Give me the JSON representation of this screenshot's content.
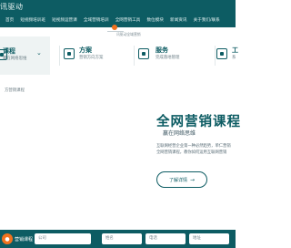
{
  "header": {
    "logo_text": "讯驱动",
    "nav": [
      "首页",
      "短视频培训班",
      "短视频运营课",
      "全域营销培训",
      "全网营销工具",
      "数位模块",
      "新闻资讯",
      "关于我们/联系"
    ]
  },
  "banner": {
    "logo_text": "讯驱动全域营销"
  },
  "features": [
    {
      "title": "课程",
      "subtitle": "赢在网络思维",
      "icon": "course-icon"
    },
    {
      "title": "方案",
      "subtitle": "营销方向方案",
      "icon": "plan-icon"
    },
    {
      "title": "服务",
      "subtitle": "完成落地管理",
      "icon": "service-icon"
    },
    {
      "title": "工",
      "subtitle": "系",
      "icon": "tool-icon"
    }
  ],
  "breadcrumb": "方营销课程",
  "hero": {
    "title": "全网营销课程",
    "subtitle": "赢在网络思维",
    "desc_line1": "互联网经营企业第一种必然趋势，单仁营销",
    "desc_line2": "全网营销课程，教你如何运用互联网营销",
    "button_label": "了解详情"
  },
  "form": {
    "label": "营销课程",
    "fields": [
      "公司",
      "姓名",
      "电话",
      "地址"
    ]
  },
  "colors": {
    "primary": "#0d5c63",
    "accent": "#f0721e"
  }
}
